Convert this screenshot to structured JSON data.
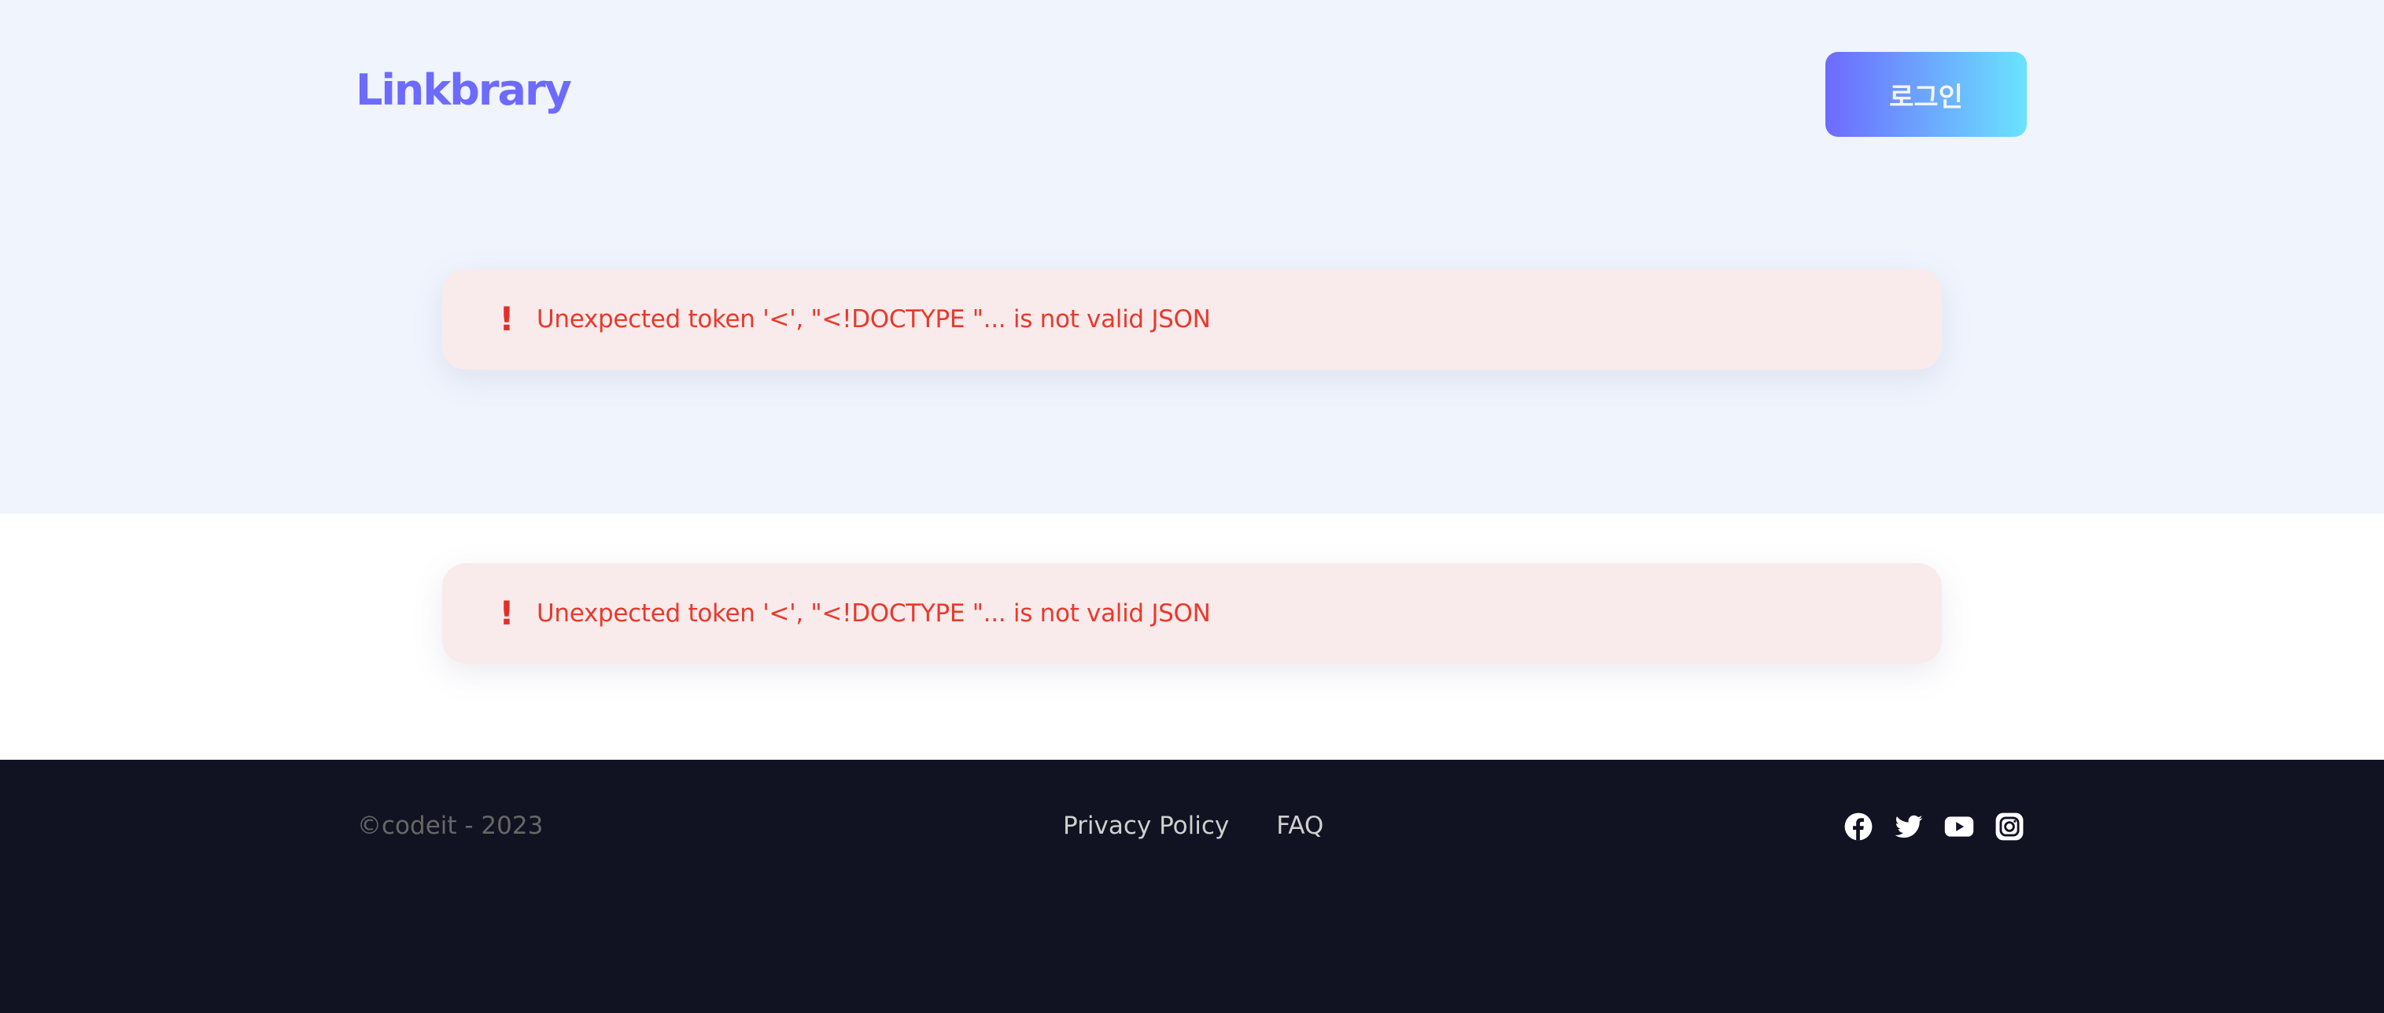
{
  "header": {
    "logo_text": "Linkbrary",
    "login_label": "로그인"
  },
  "errors": [
    {
      "icon": "exclamation-icon",
      "glyph": "!",
      "message": "Unexpected token '<', \"<!DOCTYPE \"... is not valid JSON"
    },
    {
      "icon": "exclamation-icon",
      "glyph": "!",
      "message": "Unexpected token '<', \"<!DOCTYPE \"... is not valid JSON"
    }
  ],
  "footer": {
    "copyright": "©codeit - 2023",
    "links": [
      {
        "label": "Privacy Policy"
      },
      {
        "label": "FAQ"
      }
    ],
    "social": [
      "facebook-icon",
      "twitter-icon",
      "youtube-icon",
      "instagram-icon"
    ]
  },
  "colors": {
    "brand": "#6D6AFE",
    "gradient_end": "#6AE3FE",
    "hero_bg": "#EFF4FD",
    "error_bg": "#F9EBEB",
    "error_text": "#E8392D",
    "footer_bg": "#111322"
  }
}
